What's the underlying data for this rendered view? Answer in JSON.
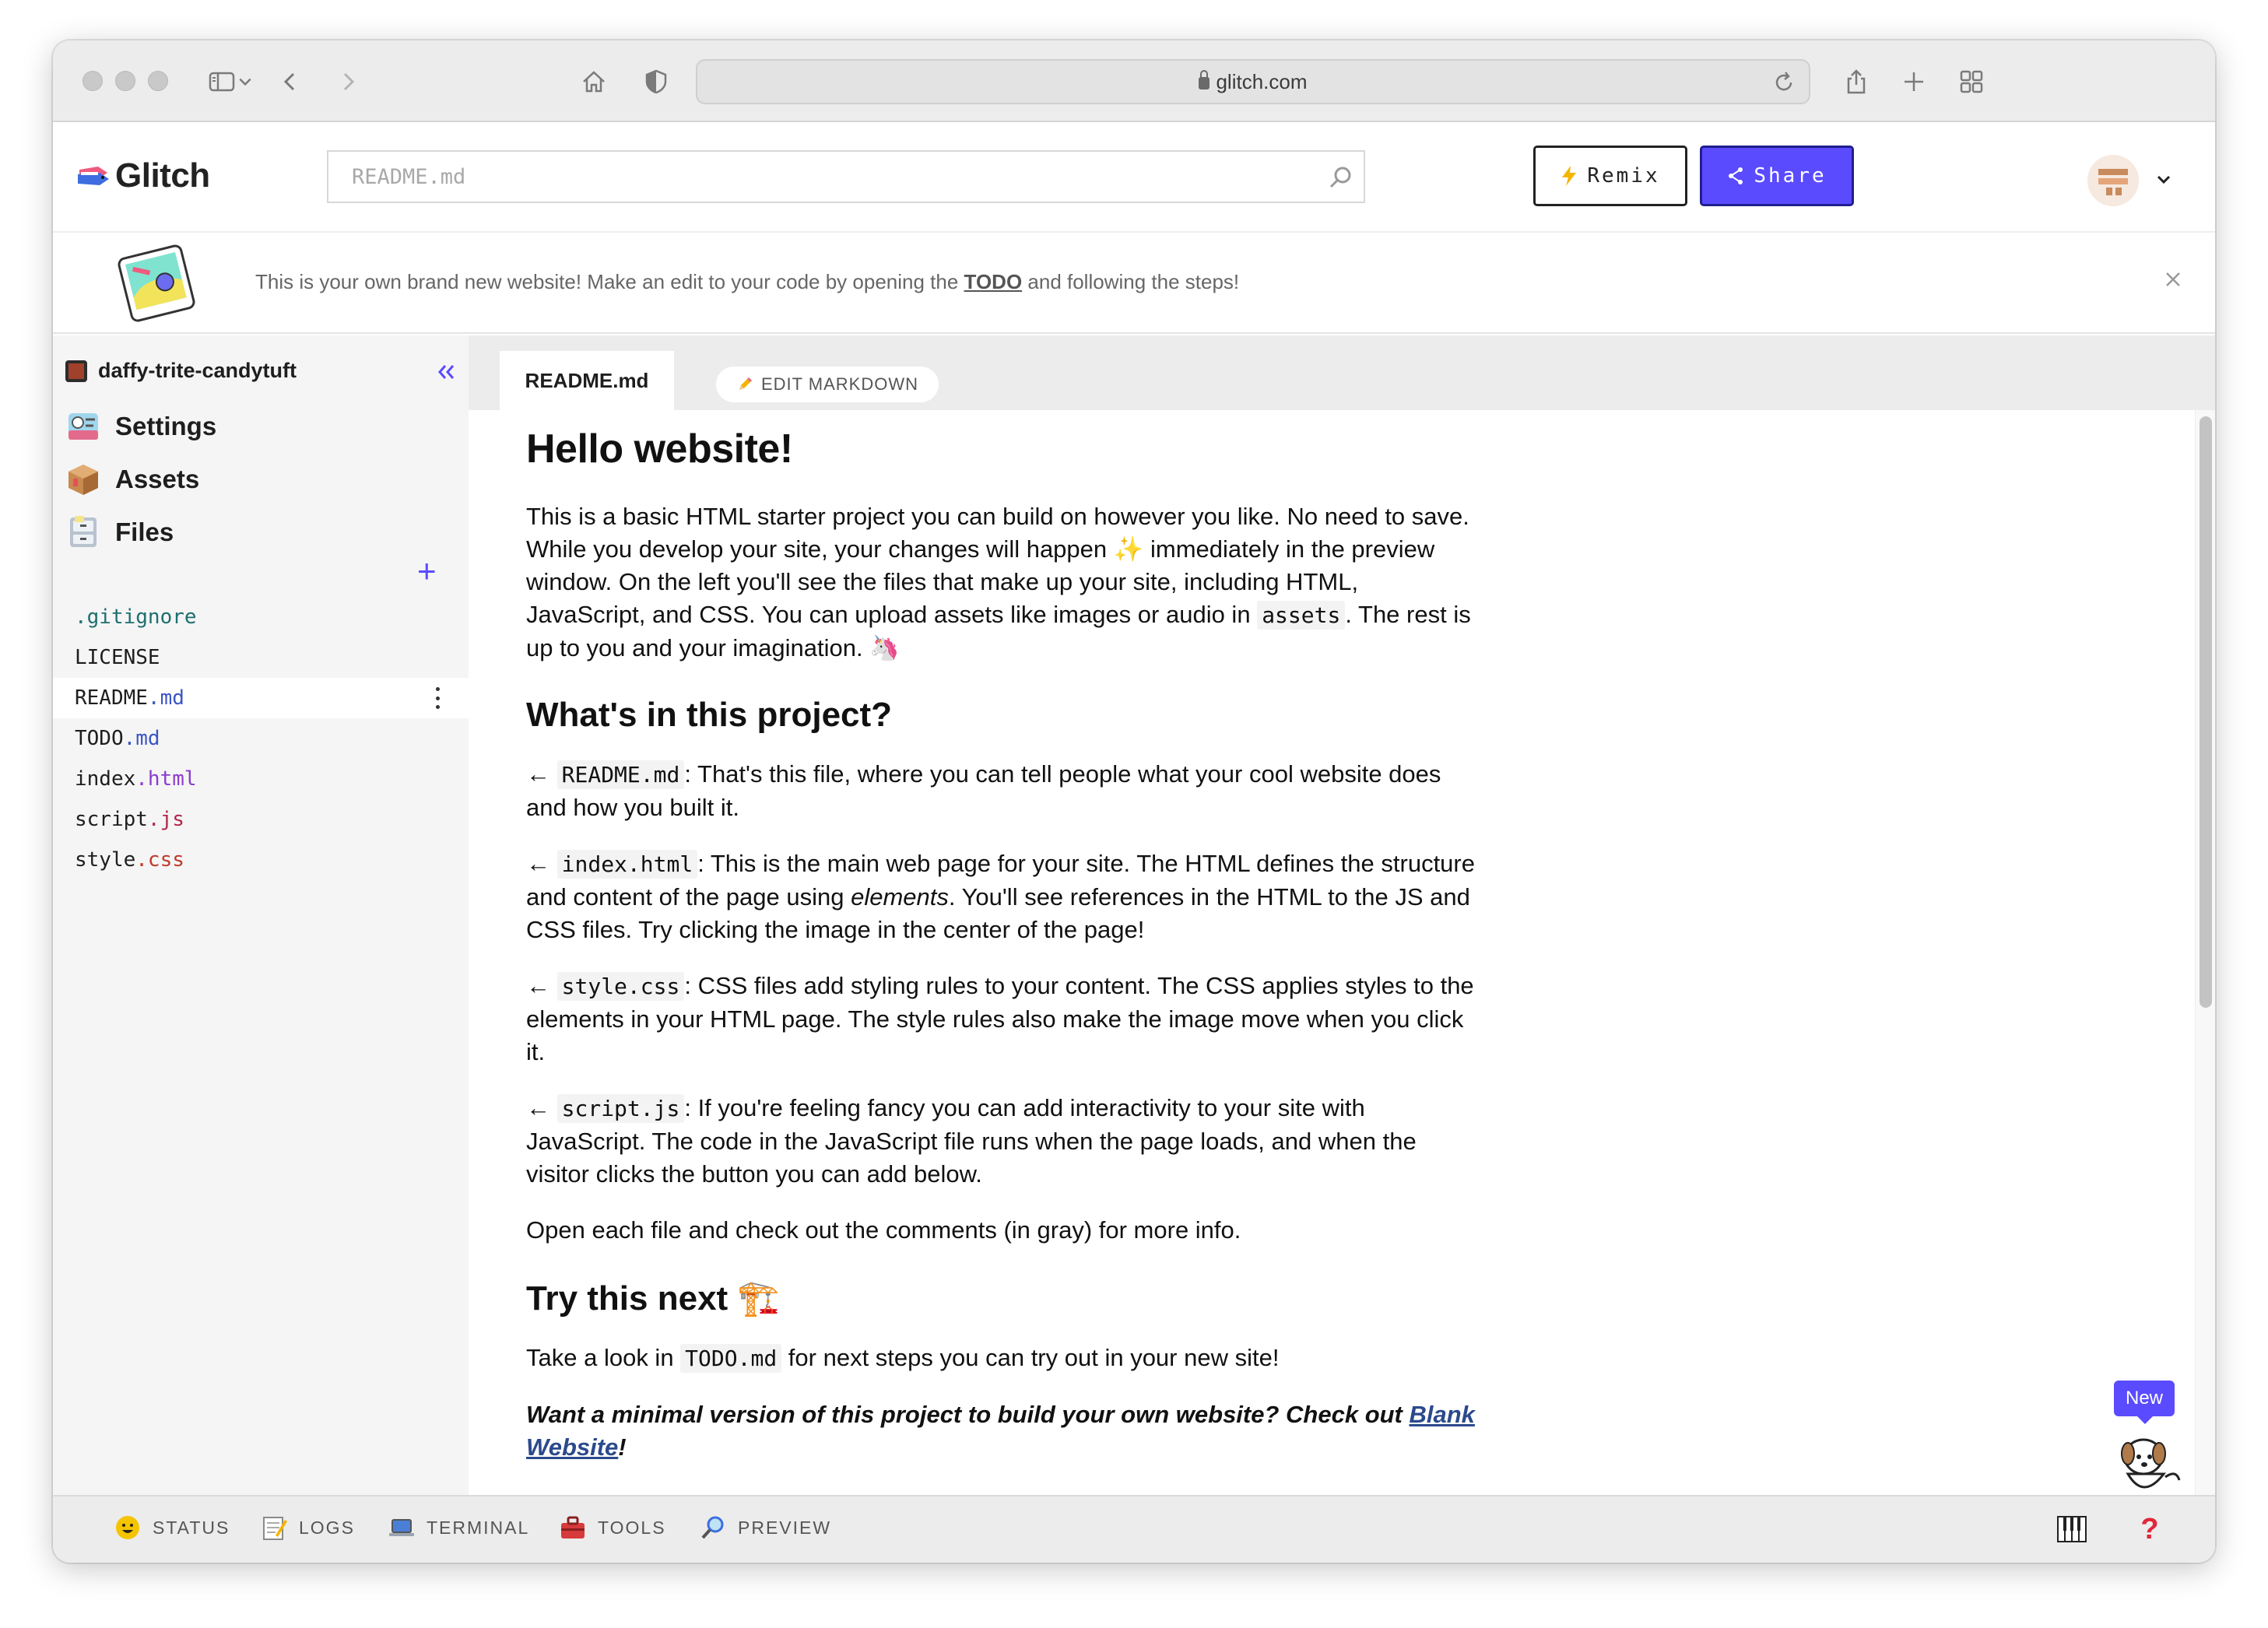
{
  "browser": {
    "url": "glitch.com"
  },
  "header": {
    "logo_text": "Glitch",
    "search_placeholder": "README.md",
    "remix_label": "Remix",
    "share_label": "Share",
    "accent_color": "#5a4bff"
  },
  "banner": {
    "text_before": "This is your own brand new website! Make an edit to your code by opening the ",
    "link_text": "TODO",
    "text_after": " and following the steps!"
  },
  "sidebar": {
    "project_name": "daffy-trite-candytuft",
    "nav": [
      {
        "label": "Settings",
        "icon": "settings-icon"
      },
      {
        "label": "Assets",
        "icon": "assets-box-icon"
      },
      {
        "label": "Files",
        "icon": "files-cabinet-icon"
      }
    ],
    "files": [
      {
        "name": ".gitignore",
        "base": ".gitignore",
        "ext": "",
        "color": "#1d6f6f"
      },
      {
        "name": "LICENSE",
        "base": "LICENSE",
        "ext": "",
        "color": "#1e1e1e"
      },
      {
        "name": "README.md",
        "base": "README",
        "ext": ".md",
        "color": "#3b55c4",
        "active": true
      },
      {
        "name": "TODO.md",
        "base": "TODO",
        "ext": ".md",
        "color": "#3b55c4"
      },
      {
        "name": "index.html",
        "base": "index",
        "ext": ".html",
        "color": "#8a3ccf"
      },
      {
        "name": "script.js",
        "base": "script",
        "ext": ".js",
        "color": "#b0284a"
      },
      {
        "name": "style.css",
        "base": "style",
        "ext": ".css",
        "color": "#c0392b"
      }
    ]
  },
  "editor": {
    "tab_label": "README.md",
    "edit_markdown_label": "EDIT MARKDOWN"
  },
  "readme": {
    "h1": "Hello website!",
    "intro": {
      "p1": "This is a basic HTML starter project you can build on however you like. No need to save. While you develop your site, your changes will happen ",
      "sparkle": "✨",
      "p2": " immediately in the preview window. On the left you'll see the files that make up your site, including HTML, JavaScript, and CSS. You can upload assets like images or audio in ",
      "code": "assets",
      "p3": ". The rest is up to you and your imagination. ",
      "unicorn": "🦄"
    },
    "h2_project": "What's in this project?",
    "items": [
      {
        "arrow": "←",
        "code": "README.md",
        "text": ": That's this file, where you can tell people what your cool website does and how you built it."
      },
      {
        "arrow": "←",
        "code": "index.html",
        "text_before": ": This is the main web page for your site. The HTML defines the structure and content of the page using ",
        "em": "elements",
        "text_after": ". You'll see references in the HTML to the JS and CSS files. Try clicking the image in the center of the page!"
      },
      {
        "arrow": "←",
        "code": "style.css",
        "text": ": CSS files add styling rules to your content. The CSS applies styles to the elements in your HTML page. The style rules also make the image move when you click it."
      },
      {
        "arrow": "←",
        "code": "script.js",
        "text": ": If you're feeling fancy you can add interactivity to your site with JavaScript. The code in the JavaScript file runs when the page loads, and when the visitor clicks the button you can add below."
      }
    ],
    "comments_note": "Open each file and check out the comments (in gray) for more info.",
    "h2_next": "Try this next",
    "h2_next_emoji": "🏗️",
    "next_before": "Take a look in ",
    "next_code": "TODO.md",
    "next_after": " for next steps you can try out in your new site!",
    "bold_before": "Want a minimal version of this project to build your own website? Check out ",
    "bold_link": "Blank Website",
    "bold_after": "!"
  },
  "mascot": {
    "badge": "New"
  },
  "bottombar": {
    "items": [
      {
        "label": "STATUS",
        "icon": "smiley-icon"
      },
      {
        "label": "LOGS",
        "icon": "notepad-icon"
      },
      {
        "label": "TERMINAL",
        "icon": "laptop-icon"
      },
      {
        "label": "TOOLS",
        "icon": "toolbox-icon"
      },
      {
        "label": "PREVIEW",
        "icon": "magnifier-icon"
      }
    ],
    "help_label": "?"
  }
}
